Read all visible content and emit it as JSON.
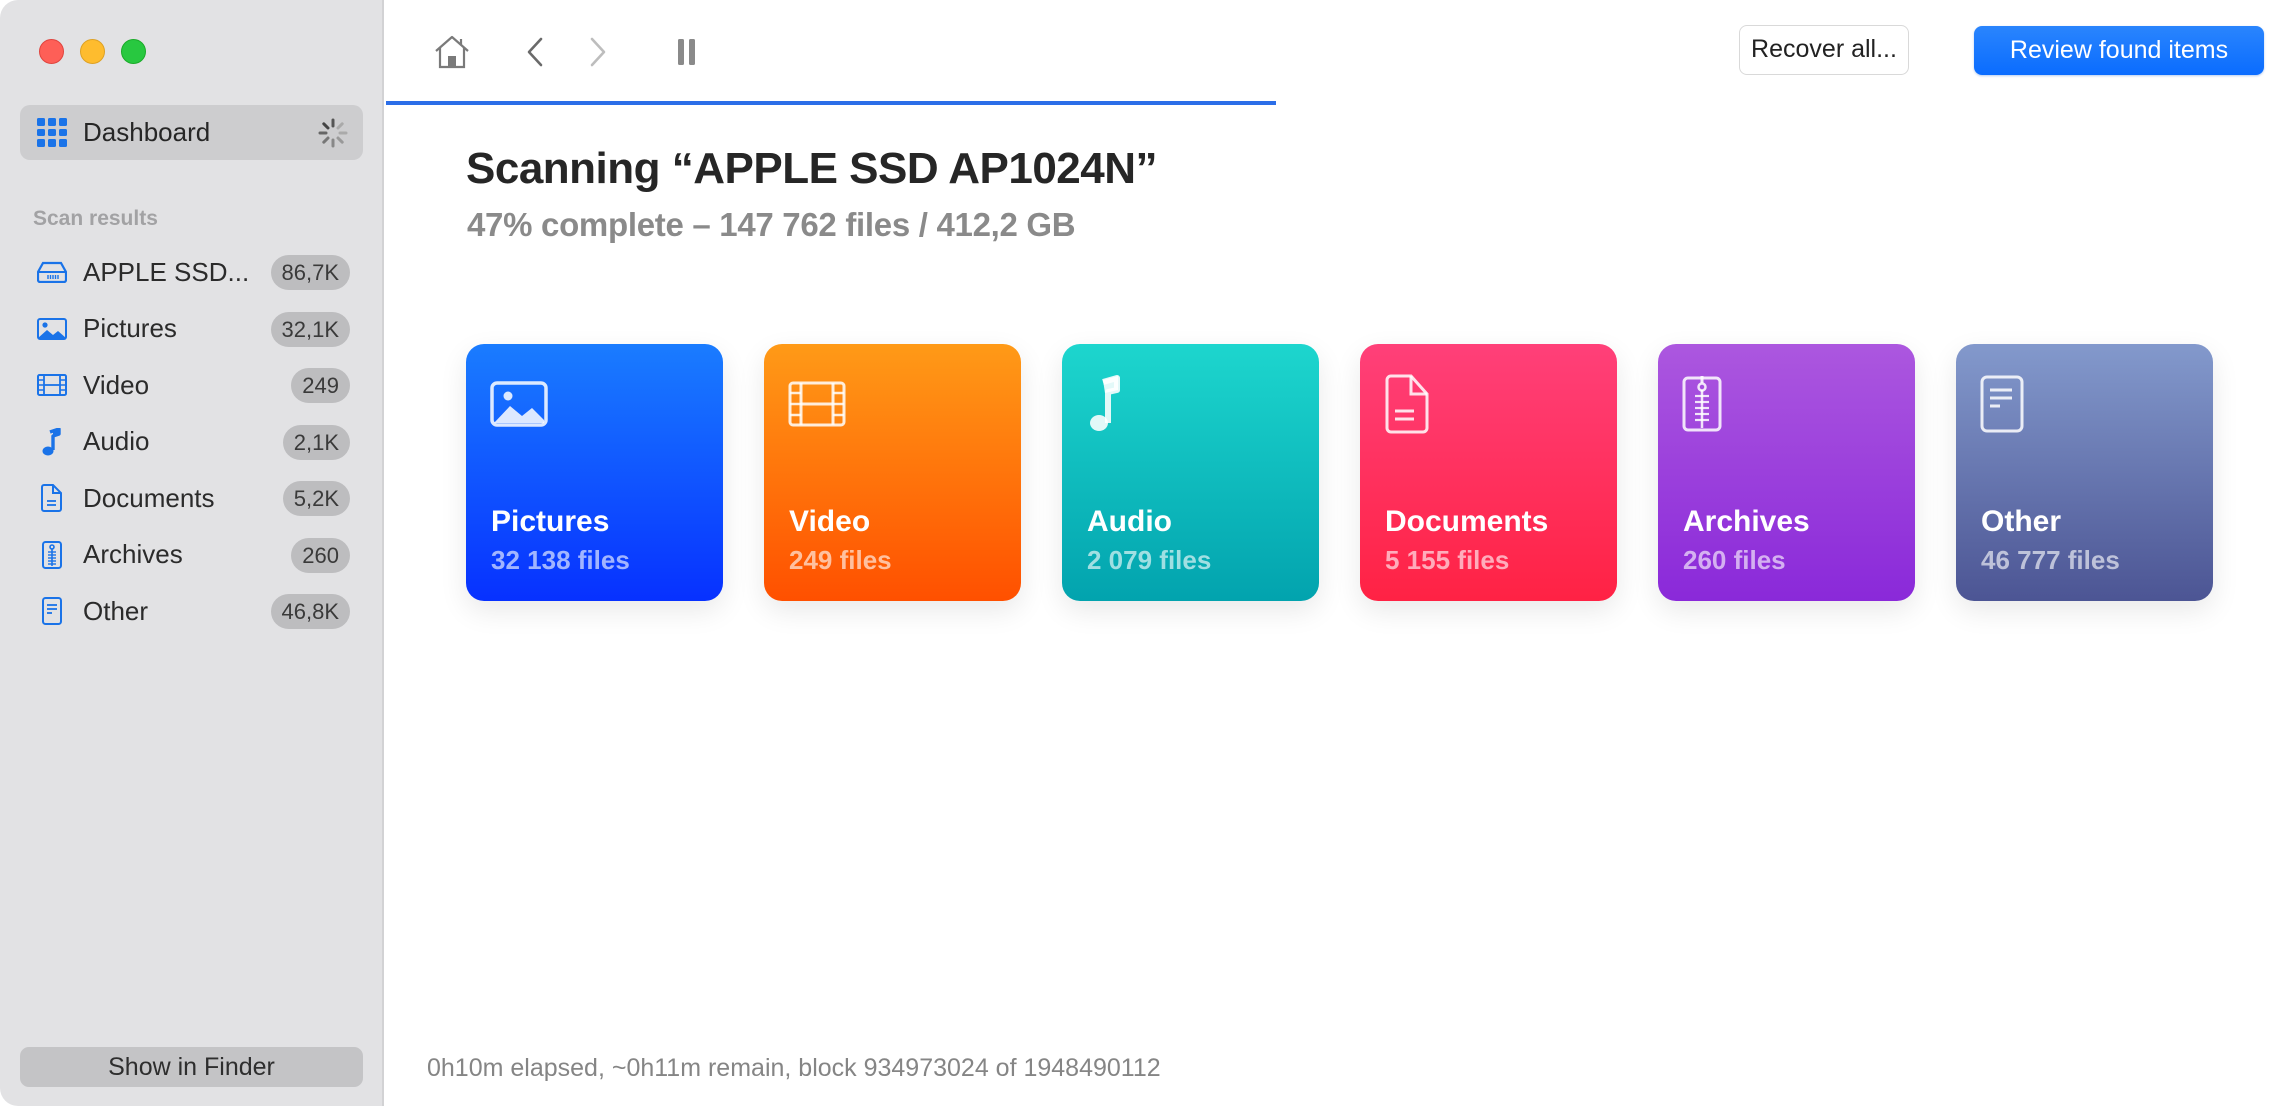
{
  "window": {
    "traffic_lights": [
      "close",
      "minimize",
      "maximize"
    ]
  },
  "sidebar": {
    "dashboard": {
      "label": "Dashboard",
      "icon": "grid-icon",
      "status": "loading-spinner"
    },
    "section_label": "Scan results",
    "items": [
      {
        "label": "APPLE SSD...",
        "count": "86,7K",
        "icon": "drive-icon"
      },
      {
        "label": "Pictures",
        "count": "32,1K",
        "icon": "pictures-icon"
      },
      {
        "label": "Video",
        "count": "249",
        "icon": "video-icon"
      },
      {
        "label": "Audio",
        "count": "2,1K",
        "icon": "music-note-icon"
      },
      {
        "label": "Documents",
        "count": "5,2K",
        "icon": "document-icon"
      },
      {
        "label": "Archives",
        "count": "260",
        "icon": "archive-icon"
      },
      {
        "label": "Other",
        "count": "46,8K",
        "icon": "other-file-icon"
      }
    ],
    "show_in_finder": "Show in Finder"
  },
  "toolbar": {
    "icons": [
      "home-icon",
      "back-icon",
      "forward-icon",
      "pause-icon"
    ],
    "recover_all": "Recover all...",
    "review_found": "Review found items",
    "accent_color": "#0a6cff"
  },
  "scan": {
    "title": "Scanning “APPLE SSD AP1024N”",
    "subtitle": "47% complete – 147 762 files / 412,2 GB",
    "progress_percent": 47,
    "status_line": "0h10m elapsed, ~0h11m remain, block 934973024 of 1948490112"
  },
  "cards": [
    {
      "name": "Pictures",
      "count": "32 138 files",
      "icon": "pictures-icon",
      "color_top": "#1a7cff",
      "color_bottom": "#0731ff"
    },
    {
      "name": "Video",
      "count": "249 files",
      "icon": "video-icon",
      "color_top": "#ff9a17",
      "color_bottom": "#ff5000"
    },
    {
      "name": "Audio",
      "count": "2 079 files",
      "icon": "music-note-icon",
      "color_top": "#1dd6ce",
      "color_bottom": "#02a3ae"
    },
    {
      "name": "Documents",
      "count": "5 155 files",
      "icon": "document-icon",
      "color_top": "#ff4079",
      "color_bottom": "#ff2244"
    },
    {
      "name": "Archives",
      "count": "260 files",
      "icon": "archive-icon",
      "color_top": "#ac57df",
      "color_bottom": "#8a29d9"
    },
    {
      "name": "Other",
      "count": "46 777 files",
      "icon": "other-file-icon",
      "color_top": "#8399cc",
      "color_bottom": "#4c5594"
    }
  ]
}
